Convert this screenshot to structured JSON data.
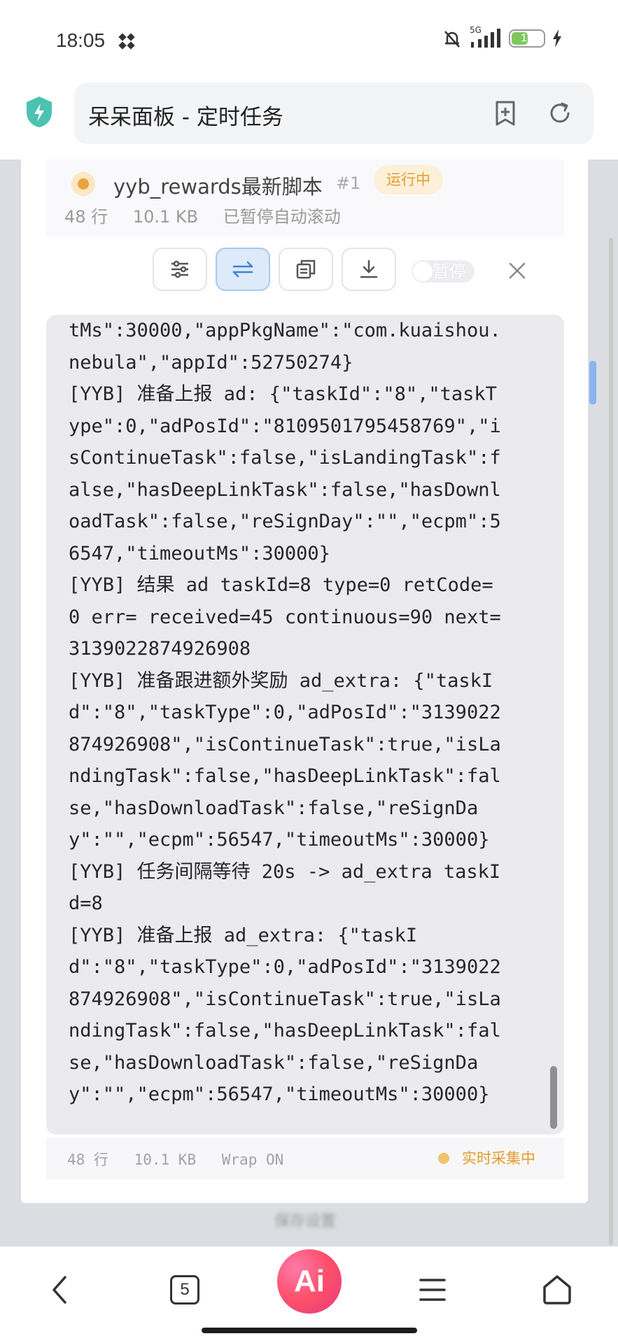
{
  "status_bar": {
    "time": "18:05",
    "network": "5G",
    "battery_level": 17,
    "battery_color": "#7ec85f",
    "icons": [
      "app-notification-icon",
      "mute-bell-icon",
      "signal-icon",
      "battery-icon",
      "charging-icon"
    ]
  },
  "browser": {
    "page_title": "呆呆面板 - 定时任务",
    "icons": [
      "shield-icon",
      "add-bookmark-icon",
      "refresh-icon"
    ]
  },
  "task": {
    "name": "yyb_rewards最新脚本",
    "number": "#1",
    "status": "运行中",
    "status_color": "#e39b2d",
    "lines": "48 行",
    "size": "10.1 KB",
    "autoscroll": "已暂停自动滚动"
  },
  "toolbar": {
    "buttons": [
      "settings-sliders-icon",
      "wrap-icon",
      "copy-icon",
      "download-icon"
    ],
    "active_button": "wrap-icon",
    "pause_toggle_label": "暂停",
    "pause_on": false,
    "close_icon": "close-icon"
  },
  "log": {
    "lines": [
      "tMs\":30000,\"appPkgName\":\"com.kuaishou.",
      "nebula\",\"appId\":52750274}",
      "[YYB] 准备上报 ad: {\"taskId\":\"8\",\"taskT",
      "ype\":0,\"adPosId\":\"8109501795458769\",\"i",
      "sContinueTask\":false,\"isLandingTask\":f",
      "alse,\"hasDeepLinkTask\":false,\"hasDownl",
      "oadTask\":false,\"reSignDay\":\"\",\"ecpm\":5",
      "6547,\"timeoutMs\":30000}",
      "[YYB] 结果 ad taskId=8 type=0 retCode=",
      "0 err= received=45 continuous=90 next=",
      "3139022874926908",
      "[YYB] 准备跟进额外奖励 ad_extra: {\"taskI",
      "d\":\"8\",\"taskType\":0,\"adPosId\":\"3139022",
      "874926908\",\"isContinueTask\":true,\"isLa",
      "ndingTask\":false,\"hasDeepLinkTask\":fal",
      "se,\"hasDownloadTask\":false,\"reSignDa",
      "y\":\"\",\"ecpm\":56547,\"timeoutMs\":30000}",
      "[YYB] 任务间隔等待 20s -> ad_extra taskI",
      "d=8",
      "[YYB] 准备上报 ad_extra: {\"taskI",
      "d\":\"8\",\"taskType\":0,\"adPosId\":\"3139022",
      "874926908\",\"isContinueTask\":true,\"isLa",
      "ndingTask\":false,\"hasDeepLinkTask\":fal",
      "se,\"hasDownloadTask\":false,\"reSignDa",
      "y\":\"\",\"ecpm\":56547,\"timeoutMs\":30000}"
    ]
  },
  "footer": {
    "lines": "48 行",
    "size": "10.1 KB",
    "wrap": "Wrap ON",
    "live": "实时采集中"
  },
  "background_blur_text": "保存设置",
  "bottom_nav": {
    "tab_count": "5",
    "ai_label": "Ai",
    "icons": [
      "back-icon",
      "tabs-icon",
      "ai-assistant-icon",
      "menu-icon",
      "home-icon"
    ]
  }
}
